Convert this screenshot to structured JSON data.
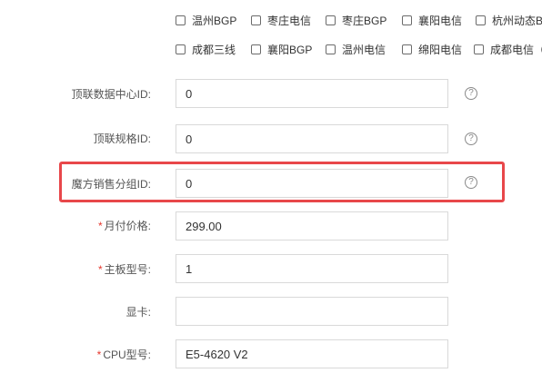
{
  "lines": {
    "row1": [
      "温州BGP",
      "枣庄电信",
      "枣庄BGP",
      "襄阳电信",
      "杭州动态B"
    ],
    "row2": [
      "成都三线",
      "襄阳BGP",
      "温州电信",
      "绵阳电信",
      "成都电信（"
    ]
  },
  "fields": {
    "dingyun_dc_id": {
      "label": "顶联数据中心ID:",
      "value": "0",
      "required": false
    },
    "dingyun_spec_id": {
      "label": "顶联规格ID:",
      "value": "0",
      "required": false
    },
    "mofang_group_id": {
      "label": "魔方销售分组ID:",
      "value": "0",
      "required": false
    },
    "monthly_price": {
      "label": "月付价格:",
      "value": "299.00",
      "required": true
    },
    "motherboard": {
      "label": "主板型号:",
      "value": "1",
      "required": true
    },
    "gpu": {
      "label": "显卡:",
      "value": "",
      "required": false
    },
    "cpu": {
      "label": "CPU型号:",
      "value": "E5-4620 V2",
      "required": true
    }
  },
  "icons": {
    "help": "question-circle-icon"
  },
  "colors": {
    "highlight": "#e8474a",
    "required": "#e5372d"
  },
  "required_mark": "*",
  "help_glyph": "?"
}
